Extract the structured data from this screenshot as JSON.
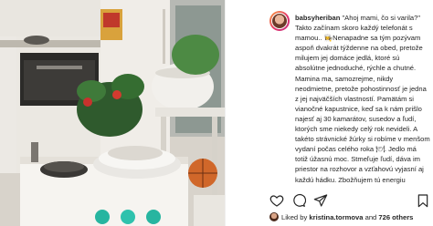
{
  "post": {
    "username": "babsyheriban",
    "caption_text": " \"Ahoj mami, čo si varila?\" Takto začínam skoro každý telefonát s mamou.. 👩‍🍳Nenapadne sa tým pozývam aspoň dvakrát týždenne na obed, pretože milujem jej domáce jedlá, ktoré sú absolútne jednoduché, rýchle a chutné. Mamina ma, samozrejme, nikdy neodmietne, pretože pohostinnosť je jedna z jej najväčších vlastností. Pamätám si vianočné kapustnice, keď sa k nám prišlo najesť aj 30 kamarátov, susedov a ľudí, ktorých sme niekedy celý rok nevideli. A takéto strávnické žúrky si robíme v menšom vydaní počas celého roka 🍽. Jedlo má totiž úžasnú moc. Stmeľuje ľudí, dáva im priestor na rozhovor a vzťahovú vyjasní aj každú hádku. Zbožňujem tú energiu",
    "likes_prefix": "Liked by ",
    "liked_by_user": "kristina.tormova",
    "likes_middle": " and ",
    "likes_count": "726 others"
  },
  "icons": {
    "like": "heart-icon",
    "comment": "comment-icon",
    "share": "share-icon",
    "save": "bookmark-icon"
  },
  "colors": {
    "text": "#262626",
    "avatar_ring_start": "#f9a03f",
    "avatar_ring_end": "#c13584"
  }
}
